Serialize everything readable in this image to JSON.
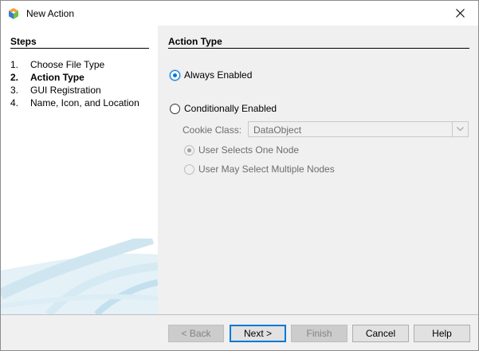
{
  "window": {
    "title": "New Action",
    "app_icon": "netbeans-cube-icon",
    "close_icon": "close-icon"
  },
  "steps": {
    "title": "Steps",
    "items": [
      {
        "num": "1.",
        "label": "Choose File Type",
        "current": false
      },
      {
        "num": "2.",
        "label": "Action Type",
        "current": true
      },
      {
        "num": "3.",
        "label": "GUI Registration",
        "current": false
      },
      {
        "num": "4.",
        "label": "Name, Icon, and Location",
        "current": false
      }
    ]
  },
  "content": {
    "title": "Action Type",
    "always_enabled": {
      "label": "Always Enabled",
      "selected": true
    },
    "conditionally_enabled": {
      "label": "Conditionally Enabled",
      "selected": false
    },
    "cookie_class": {
      "label": "Cookie Class:",
      "value": "DataObject",
      "enabled": false
    },
    "user_selects_one": {
      "label": "User Selects One Node",
      "selected": true,
      "enabled": false
    },
    "user_may_select_multiple": {
      "label": "User May Select Multiple Nodes",
      "selected": false,
      "enabled": false
    }
  },
  "buttons": {
    "back": {
      "label": "< Back",
      "enabled": false
    },
    "next": {
      "label": "Next >",
      "enabled": true
    },
    "finish": {
      "label": "Finish",
      "enabled": false
    },
    "cancel": {
      "label": "Cancel",
      "enabled": true
    },
    "help": {
      "label": "Help",
      "enabled": true
    }
  },
  "colors": {
    "accent": "#0078d7",
    "panel_white": "#ffffff",
    "dialog_bg": "#f0f0f0"
  }
}
